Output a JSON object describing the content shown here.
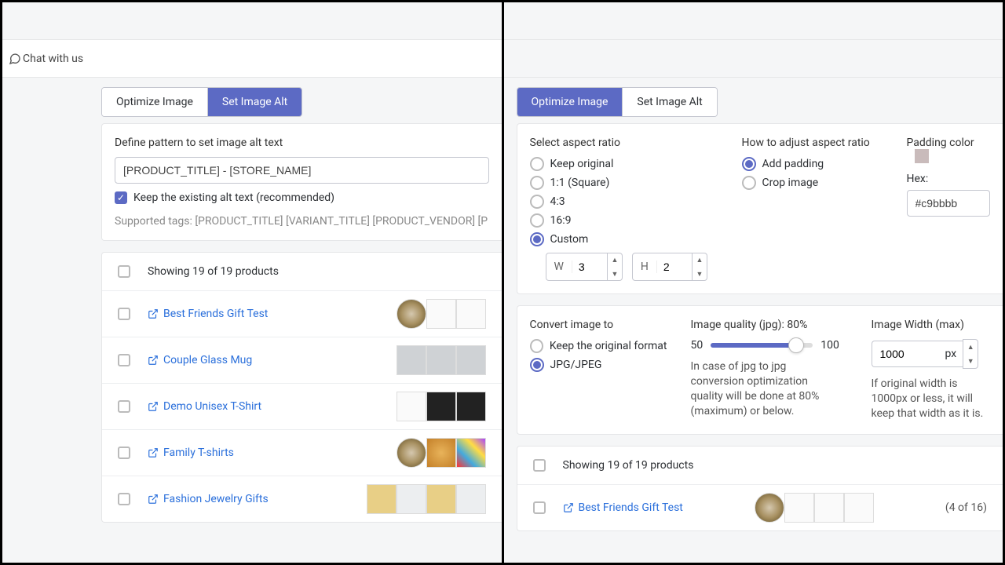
{
  "chat": {
    "label": "Chat with us"
  },
  "tabs": {
    "optimize": "Optimize Image",
    "setAlt": "Set Image Alt"
  },
  "left": {
    "defineLabel": "Define pattern to set image alt text",
    "pattern": "[PRODUCT_TITLE] - [STORE_NAME]",
    "keepExisting": "Keep the existing alt text (recommended)",
    "supportedTags": "Supported tags: [PRODUCT_TITLE]   [VARIANT_TITLE]   [PRODUCT_VENDOR]   [P",
    "showing": "Showing 19 of 19 products",
    "products": [
      "Best Friends Gift Test",
      "Couple Glass Mug",
      "Demo Unisex T-Shirt",
      "Family T-shirts",
      "Fashion Jewelry Gifts"
    ]
  },
  "right": {
    "aspect": {
      "title": "Select aspect ratio",
      "options": [
        "Keep original",
        "1:1 (Square)",
        "4:3",
        "16:9",
        "Custom"
      ],
      "selected": "Custom",
      "w": "3",
      "h": "2"
    },
    "adjust": {
      "title": "How to adjust aspect ratio",
      "options": [
        "Add padding",
        "Crop image"
      ],
      "selected": "Add padding"
    },
    "padding": {
      "title": "Padding color",
      "hexLabel": "Hex:",
      "hex": "#c9bbbb"
    },
    "convert": {
      "title": "Convert image to",
      "options": [
        "Keep the original format",
        "JPG/JPEG"
      ],
      "selected": "JPG/JPEG"
    },
    "quality": {
      "title": "Image quality (jpg): 80%",
      "min": "50",
      "max": "100",
      "hint": "In case of jpg to jpg conversion optimization quality will be done at 80%(maximum) or below."
    },
    "width": {
      "title": "Image Width (max)",
      "value": "1000",
      "unit": "px",
      "hint": "If original width is 1000px or less, it will keep that width as it is."
    },
    "showing": "Showing 19 of 19 products",
    "product": "Best Friends Gift Test",
    "count": "(4 of 16)"
  }
}
